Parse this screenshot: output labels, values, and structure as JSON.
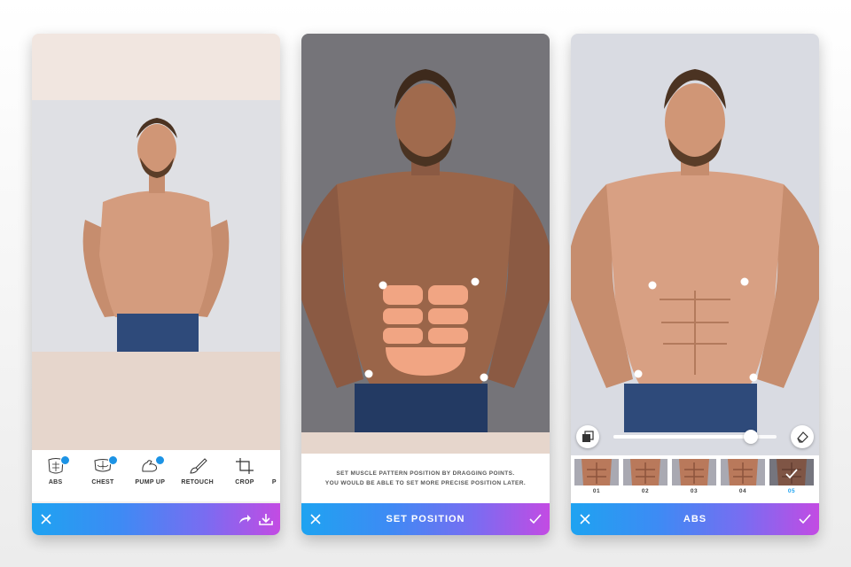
{
  "screen1": {
    "tools": [
      {
        "label": "ABS",
        "icon": "abs-icon",
        "premium": true
      },
      {
        "label": "CHEST",
        "icon": "chest-icon",
        "premium": true
      },
      {
        "label": "PUMP UP",
        "icon": "flexed-arm-icon",
        "premium": true
      },
      {
        "label": "RETOUCH",
        "icon": "brush-icon",
        "premium": false
      },
      {
        "label": "CROP",
        "icon": "crop-icon",
        "premium": false
      }
    ],
    "partial_tool_label": "P",
    "bar_icons": [
      "close-icon",
      "redo-icon",
      "download-icon"
    ]
  },
  "screen2": {
    "instruction_line1": "SET MUSCLE PATTERN POSITION BY DRAGGING POINTS.",
    "instruction_line2": "YOU WOULD BE ABLE TO SET MORE PRECISE POSITION LATER.",
    "bar_title": "SET POSITION"
  },
  "screen3": {
    "bar_title": "ABS",
    "slider_value": 0.84,
    "thumbnails": [
      {
        "label": "01",
        "selected": false
      },
      {
        "label": "02",
        "selected": false
      },
      {
        "label": "03",
        "selected": false
      },
      {
        "label": "04",
        "selected": false
      },
      {
        "label": "05",
        "selected": true
      }
    ]
  },
  "colors": {
    "accent_blue": "#1ea3f1",
    "accent_purple": "#c34be3",
    "premium_badge": "#1c93e5"
  }
}
